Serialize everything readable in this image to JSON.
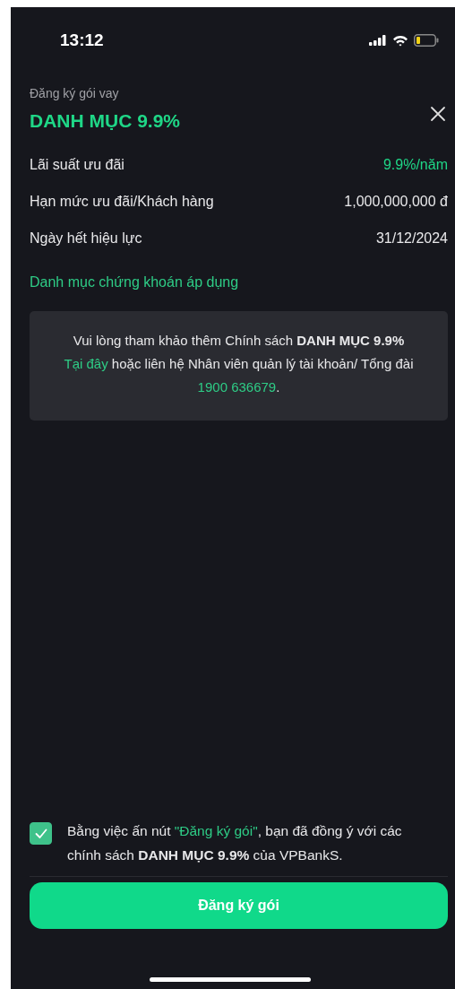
{
  "status_bar": {
    "time": "13:12"
  },
  "header": {
    "subtitle": "Đăng ký gói vay",
    "title": "DANH MỤC 9.9%"
  },
  "details": [
    {
      "label": "Lãi suất ưu đãi",
      "value": "9.9%/năm",
      "kind": "highlight"
    },
    {
      "label": "Hạn mức ưu đãi/Khách hàng",
      "value": "1,000,000,000 đ",
      "kind": "plain"
    },
    {
      "label": "Ngày hết hiệu lực",
      "value": "31/12/2024",
      "kind": "plain"
    }
  ],
  "securities_link": "Danh mục chứng khoán áp dụng",
  "info_box": [
    {
      "kind": "text",
      "text": "Vui lòng tham khảo thêm Chính sách **DANH MỤC 9.9%**"
    },
    {
      "kind": "link",
      "text": "Tại đây"
    },
    {
      "kind": "text",
      "text": "hoặc liên hệ Nhân viên quản lý tài khoản/ Tổng đài"
    },
    {
      "kind": "phone",
      "text": "1900 636679"
    },
    {
      "kind": "tail",
      "text": "."
    }
  ],
  "agreement": {
    "checked": true,
    "parts": [
      {
        "kind": "text",
        "text": "Bằng việc ấn nút"
      },
      {
        "kind": "link",
        "text": "\"Đăng ký gói\""
      },
      {
        "kind": "tail",
        "text": ", bạn đã đồng ý với các chính sách **DANH MỤC 9.9%** của VPBankS."
      }
    ]
  },
  "submit_button": "Đăng ký gói"
}
